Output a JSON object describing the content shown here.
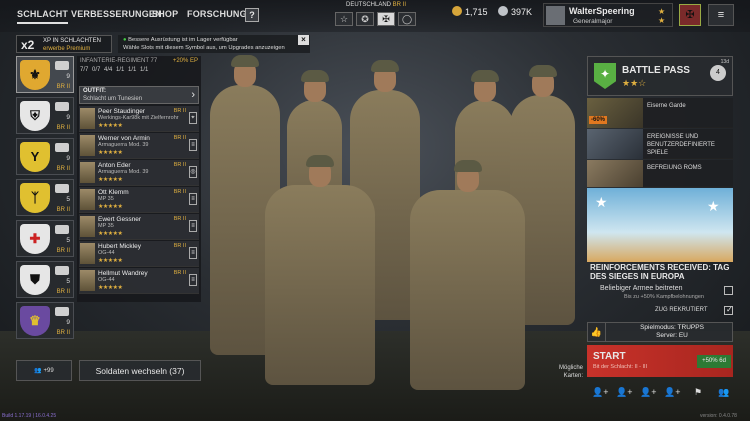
{
  "nav": {
    "tabs": [
      {
        "label": "SCHLACHT",
        "active": true
      },
      {
        "label": "VERBESSERUNGEN"
      },
      {
        "label": "SHOP"
      },
      {
        "label": "FORSCHUNG"
      }
    ],
    "help_label": "?"
  },
  "nation": {
    "name": "DEUTSCHLAND",
    "br": "BR II",
    "icons": [
      "star-icon",
      "allies-star-icon",
      "cross-icon",
      "circle-icon"
    ]
  },
  "currency": {
    "gold": "1,715",
    "silver": "397K"
  },
  "player": {
    "name": "WalterSpeering",
    "rank": "Generalmajor"
  },
  "xp_boost": {
    "mult": "x2",
    "line1": "XP IN SCHLACHTEN",
    "line2": "erwerbe Premium"
  },
  "notice": {
    "line1": "Bessere Ausrüstung ist im Lager verfügbar",
    "line2": "Wähle Slots mit diesem Symbol aus, um Upgrades anzuzeigen"
  },
  "squads": [
    {
      "count": "9",
      "br": "BR II",
      "active": true,
      "emblem": "eagle"
    },
    {
      "count": "9",
      "br": "BR II",
      "emblem": "crest"
    },
    {
      "count": "9",
      "br": "BR II",
      "emblem": "Y"
    },
    {
      "count": "5",
      "br": "BR II",
      "emblem": "rune"
    },
    {
      "count": "5",
      "br": "BR II",
      "emblem": "red-cross"
    },
    {
      "count": "5",
      "br": "BR II",
      "emblem": "shield"
    },
    {
      "count": "9",
      "br": "BR II",
      "emblem": "coat"
    }
  ],
  "regiment": {
    "name": "INFANTERIE-REGIMENT 77",
    "ep": "+20% EP",
    "counts": "7/7   0/7 4/4 1/1 1/1 1/1",
    "outfit_label": "OUTFIT:",
    "outfit_value": "Schlacht um Tunesien"
  },
  "soldiers": [
    {
      "name": "Peer Staudinger",
      "weapon": "Werkings-Kar98k mit Zielfernrohr",
      "stars": "★★★★★",
      "br": "BR II"
    },
    {
      "name": "Werner von Armin",
      "weapon": "Armaguerra Mod. 39",
      "stars": "★★★★★",
      "br": "BR II"
    },
    {
      "name": "Anton Eder",
      "weapon": "Armaguerra Mod. 39",
      "stars": "★★★★★",
      "br": "BR II"
    },
    {
      "name": "Ott Klemm",
      "weapon": "MP 35",
      "stars": "★★★★★",
      "br": "BR II"
    },
    {
      "name": "Ewert Gessner",
      "weapon": "MP 35",
      "stars": "★★★★★",
      "br": "BR II"
    },
    {
      "name": "Hubert Mickley",
      "weapon": "OG-44",
      "stars": "★★★★★",
      "br": "BR II"
    },
    {
      "name": "Hellmut Wandrey",
      "weapon": "OG-44",
      "stars": "★★★★★",
      "br": "BR II"
    }
  ],
  "bottom": {
    "reserve": "+99",
    "switch_label": "Soldaten wechseln (37)",
    "cards": "Mögliche Karten:"
  },
  "battlepass": {
    "title": "BATTLE PASS",
    "stars": "★★☆",
    "level": "4",
    "days": "13d"
  },
  "events": [
    {
      "text": "Eiserne Garde",
      "tag": "-60%"
    },
    {
      "text": "EREIGNISSE UND BENUTZERDEFINIERTE SPIELE"
    },
    {
      "text": "BEFREIUNG ROMS"
    }
  ],
  "reinforcement": "REINFORCEMENTS RECEIVED: TAG DES SIEGES IN EUROPA",
  "join_army": {
    "label": "Beliebiger Armee beitreten",
    "sub": "Bis zu +50% Kampfbelohnungen"
  },
  "recruit": {
    "label": "ZUG REKRUTIERT"
  },
  "gamemode": {
    "mode": "Spielmodus: TRUPPS",
    "server": "Server: EU"
  },
  "start": {
    "label": "START",
    "sub": "Bit der Schlacht: II - III",
    "bonus": "+50% 6d"
  },
  "footer": {
    "version": "Build 1.17.19  |  16.0.4.25",
    "build": "version: 0.4.0.78"
  }
}
